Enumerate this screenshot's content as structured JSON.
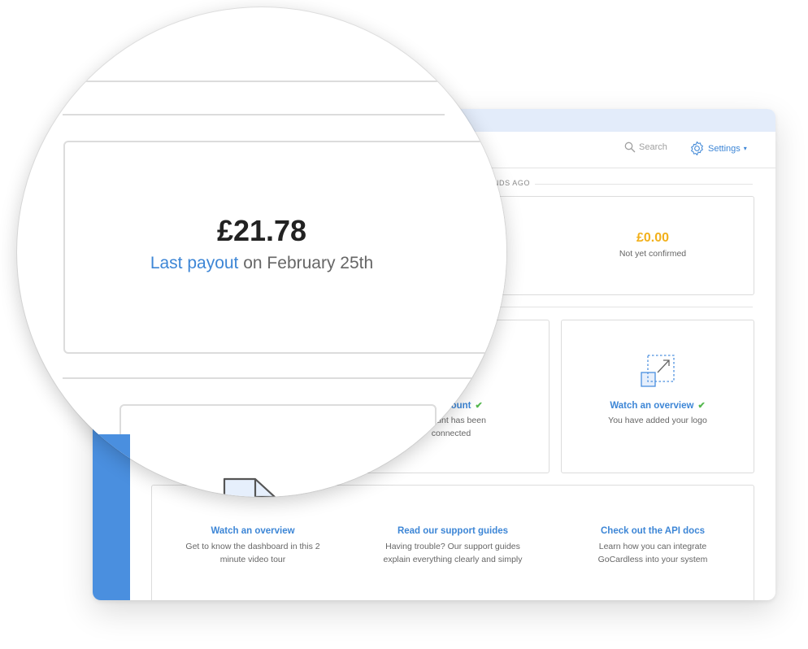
{
  "header": {
    "search_label": "Search",
    "settings_label": "Settings",
    "settings_caret": "▾"
  },
  "updated_label": "...ONDS AGO",
  "balance": {
    "amount": "£21.78",
    "payout_link": "Last payout",
    "payout_rest": " on February 25th",
    "pending_amount": "£0.00",
    "pending_label": "Not yet confirmed"
  },
  "steps": [
    {
      "title": "...k account",
      "desc_line1": "...ccount has been",
      "desc_line2": "connected",
      "done": true
    },
    {
      "title": "Watch an overview",
      "desc_line1": "You have added your logo",
      "done": true
    }
  ],
  "check_glyph": "✔",
  "help": [
    {
      "title": "Watch an overview",
      "desc_line1": "Get to know the dashboard in this 2",
      "desc_line2": "minute video tour"
    },
    {
      "title": "Read our support guides",
      "desc_line1": "Having trouble? Our support guides",
      "desc_line2": "explain everything clearly and simply"
    },
    {
      "title": "Check out the API docs",
      "desc_line1": "Learn how you can integrate",
      "desc_line2": "GoCardless into your system"
    }
  ],
  "colors": {
    "accent": "#3d86d6",
    "sidebar": "#4a8fdf",
    "pending": "#f2b01a",
    "check": "#55b84e"
  },
  "icons": [
    "search-icon",
    "gear-icon",
    "resize-arrow-icon",
    "document-icon"
  ]
}
